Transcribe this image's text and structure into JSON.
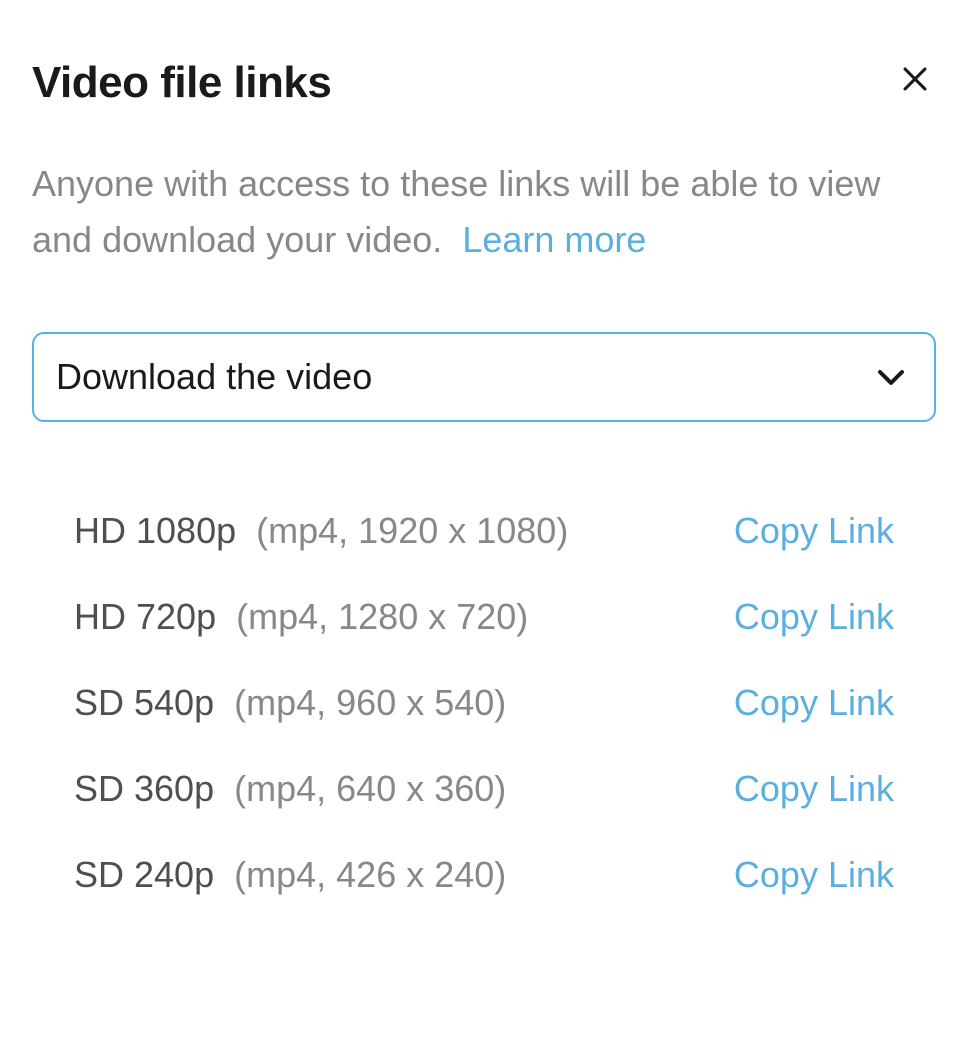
{
  "modal": {
    "title": "Video file links",
    "description_text": "Anyone with access to these links will be able to view and download your video.",
    "learn_more_label": "Learn more"
  },
  "dropdown": {
    "label": "Download the video"
  },
  "copy_link_label": "Copy Link",
  "resolutions": [
    {
      "name": "HD 1080p",
      "detail": "(mp4, 1920 x 1080)"
    },
    {
      "name": "HD 720p",
      "detail": "(mp4, 1280 x 720)"
    },
    {
      "name": "SD 540p",
      "detail": "(mp4, 960 x 540)"
    },
    {
      "name": "SD 360p",
      "detail": "(mp4, 640 x 360)"
    },
    {
      "name": "SD 240p",
      "detail": "(mp4, 426 x 240)"
    }
  ]
}
